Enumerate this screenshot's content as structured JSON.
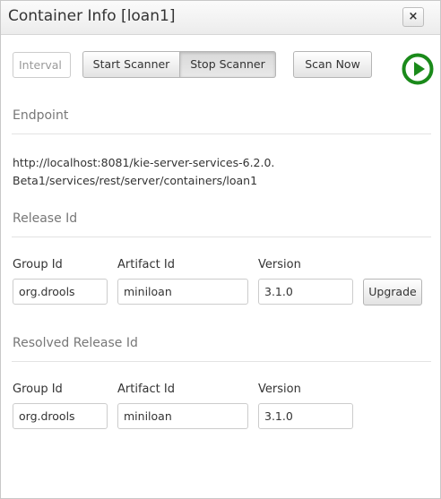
{
  "window": {
    "title": "Container Info [loan1]",
    "close_label": "×"
  },
  "scanner": {
    "interval_placeholder": "Interval",
    "start_label": "Start Scanner",
    "stop_label": "Stop Scanner",
    "scan_now_label": "Scan Now"
  },
  "endpoint": {
    "heading": "Endpoint",
    "url": "http://localhost:8081/kie-server-services-6.2.0.Beta1/services/rest/server/containers/loan1"
  },
  "release": {
    "heading": "Release Id",
    "group_label": "Group Id",
    "artifact_label": "Artifact Id",
    "version_label": "Version",
    "group_value": "org.drools",
    "artifact_value": "miniloan",
    "version_value": "3.1.0",
    "upgrade_label": "Upgrade"
  },
  "resolved": {
    "heading": "Resolved Release Id",
    "group_label": "Group Id",
    "artifact_label": "Artifact Id",
    "version_label": "Version",
    "group_value": "org.drools",
    "artifact_value": "miniloan",
    "version_value": "3.1.0"
  },
  "colors": {
    "play_icon": "#1a8a1a"
  },
  "icons": {
    "play": "play-circle-icon",
    "close": "close-icon"
  }
}
